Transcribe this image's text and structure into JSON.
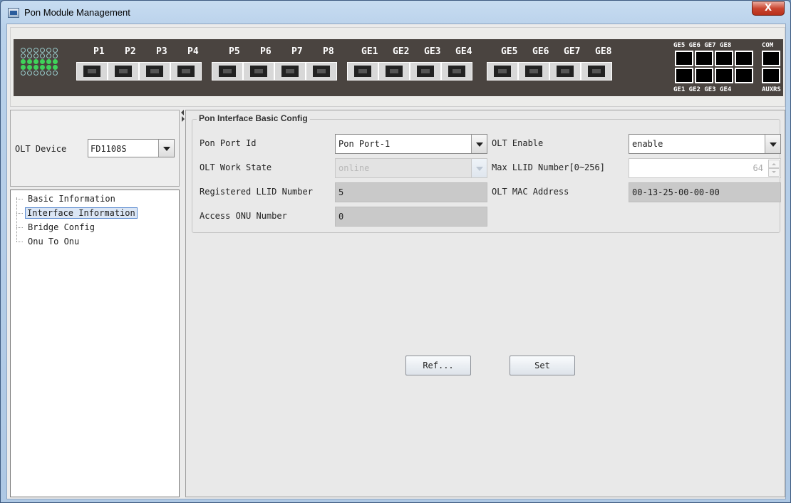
{
  "window": {
    "title": "Pon Module Management",
    "close_label": "X"
  },
  "device": {
    "pon_ports": [
      "P1",
      "P2",
      "P3",
      "P4",
      "P5",
      "P6",
      "P7",
      "P8"
    ],
    "ge_ports": [
      "GE1",
      "GE2",
      "GE3",
      "GE4",
      "GE5",
      "GE6",
      "GE7",
      "GE8"
    ],
    "rj_top_labels": [
      "GE5 GE6 GE7 GE8"
    ],
    "rj_bottom_labels": [
      "GE1 GE2 GE3 GE4"
    ],
    "com_label": "COM",
    "aux_label": "AUX",
    "rs_label": "RS"
  },
  "sidebar": {
    "olt_device_label": "OLT Device",
    "olt_device_value": "FD1108S",
    "tree": [
      {
        "label": "Basic Information"
      },
      {
        "label": "Interface Information",
        "selected": true
      },
      {
        "label": "Bridge Config"
      },
      {
        "label": "Onu To Onu"
      }
    ]
  },
  "config": {
    "group_title": "Pon Interface Basic Config",
    "pon_port_id_label": "Pon Port Id",
    "pon_port_id_value": "Pon Port-1",
    "olt_enable_label": "OLT Enable",
    "olt_enable_value": "enable",
    "olt_work_state_label": "OLT Work State",
    "olt_work_state_value": "online",
    "max_llid_label": "Max LLID Number[0~256]",
    "max_llid_value": "64",
    "registered_llid_label": "Registered LLID Number",
    "registered_llid_value": "5",
    "olt_mac_label": "OLT MAC Address",
    "olt_mac_value": "00-13-25-00-00-00",
    "access_onu_label": "Access ONU Number",
    "access_onu_value": "0"
  },
  "actions": {
    "refresh_label": "Ref...",
    "set_label": "Set"
  },
  "colors": {
    "led_on": "#3fd25a",
    "device_strip": "#4a4440",
    "selection": "#5a8ad0"
  }
}
